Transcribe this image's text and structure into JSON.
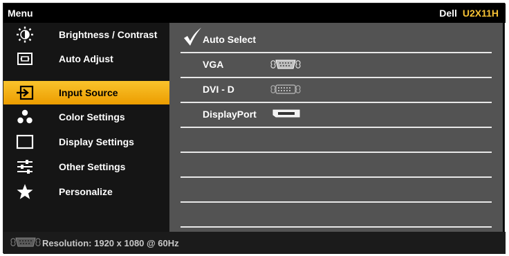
{
  "header": {
    "title": "Menu",
    "brand": "Dell",
    "model": "U2X11H",
    "model_color": "#f6c235"
  },
  "menu": {
    "items": [
      {
        "label": "Brightness / Contrast",
        "icon": "brightness-icon",
        "selected": false
      },
      {
        "label": "Auto Adjust",
        "icon": "auto-adjust-icon",
        "selected": false
      },
      {
        "label": "Input Source",
        "icon": "input-source-icon",
        "selected": true
      },
      {
        "label": "Color Settings",
        "icon": "color-settings-icon",
        "selected": false
      },
      {
        "label": "Display Settings",
        "icon": "display-settings-icon",
        "selected": false
      },
      {
        "label": "Other Settings",
        "icon": "other-settings-icon",
        "selected": false
      },
      {
        "label": "Personalize",
        "icon": "star-icon",
        "selected": false
      }
    ],
    "selected_color": "#f7b500"
  },
  "options": {
    "items": [
      {
        "label": "Auto Select",
        "checked": true,
        "icon": ""
      },
      {
        "label": "VGA",
        "checked": false,
        "icon": "vga-connector-icon"
      },
      {
        "label": "DVI - D",
        "checked": false,
        "icon": "dvi-connector-icon"
      },
      {
        "label": "DisplayPort",
        "checked": false,
        "icon": "displayport-connector-icon"
      },
      {
        "label": "",
        "checked": false,
        "icon": ""
      },
      {
        "label": "",
        "checked": false,
        "icon": ""
      },
      {
        "label": "",
        "checked": false,
        "icon": ""
      },
      {
        "label": "",
        "checked": false,
        "icon": ""
      }
    ]
  },
  "status": {
    "icon": "vga-connector-icon",
    "text": "Resolution: 1920 x 1080 @ 60Hz"
  }
}
